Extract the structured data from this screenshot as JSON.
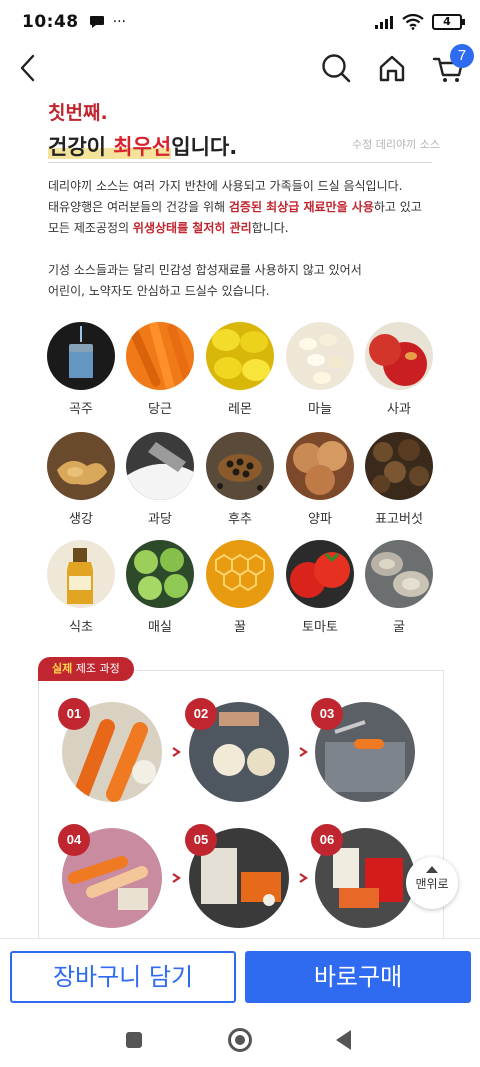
{
  "status_bar": {
    "time": "10:48",
    "battery": "4",
    "dots": "···"
  },
  "nav": {
    "cart_count": "7"
  },
  "headline": {
    "line1": "칫번째.",
    "line2_before": "건강이 ",
    "line2_red": "최우선",
    "line2_after": "입니다.",
    "caption": "수정 데리야끼 소스"
  },
  "description": {
    "p1": "데리야끼 소스는 여러 가지 반찬에 사용되고 가족들이 드실 음식입니다.",
    "p2_a": "태유양행은 여러분들의 건강을 위해 ",
    "p2_em": "검증된 최상급 재료만을 사용",
    "p2_b": "하고 있고",
    "p3_a": "모든 제조공정의 ",
    "p3_em": "위생상태를 철저히 관리",
    "p3_b": "합니다.",
    "p4": "기성 소스들과는 달리 민감성 합성재료를 사용하지 않고 있어서",
    "p5": "어린이, 노약자도 안심하고 드실수 있습니다."
  },
  "ingredients": [
    {
      "label": "곡주",
      "art": "water"
    },
    {
      "label": "당근",
      "art": "carrot"
    },
    {
      "label": "레몬",
      "art": "lemon"
    },
    {
      "label": "마늘",
      "art": "garlic"
    },
    {
      "label": "사과",
      "art": "apple"
    },
    {
      "label": "생강",
      "art": "ginger"
    },
    {
      "label": "과당",
      "art": "sugar"
    },
    {
      "label": "후추",
      "art": "pepper"
    },
    {
      "label": "양파",
      "art": "onion"
    },
    {
      "label": "표고버섯",
      "art": "mushroom"
    },
    {
      "label": "식초",
      "art": "vinegar"
    },
    {
      "label": "매실",
      "art": "plum"
    },
    {
      "label": "꿀",
      "art": "honey"
    },
    {
      "label": "토마토",
      "art": "tomato"
    },
    {
      "label": "굴",
      "art": "oyster"
    }
  ],
  "process": {
    "tag_yellow": "실제",
    "tag_rest": " 제조 과정",
    "steps": [
      "01",
      "02",
      "03",
      "04",
      "05",
      "06"
    ]
  },
  "top_button": {
    "label": "맨위로"
  },
  "bottom_bar": {
    "cart_label": "장바구니 담기",
    "buy_label": "바로구매"
  },
  "colors": {
    "accent_red": "#c0262f",
    "primary_blue": "#2f6bf0",
    "highlight_yellow": "#f4e39a"
  },
  "icons": [
    "back-icon",
    "search-icon",
    "home-icon",
    "cart-icon",
    "chat-icon",
    "signal-icon",
    "wifi-icon",
    "battery-icon"
  ]
}
